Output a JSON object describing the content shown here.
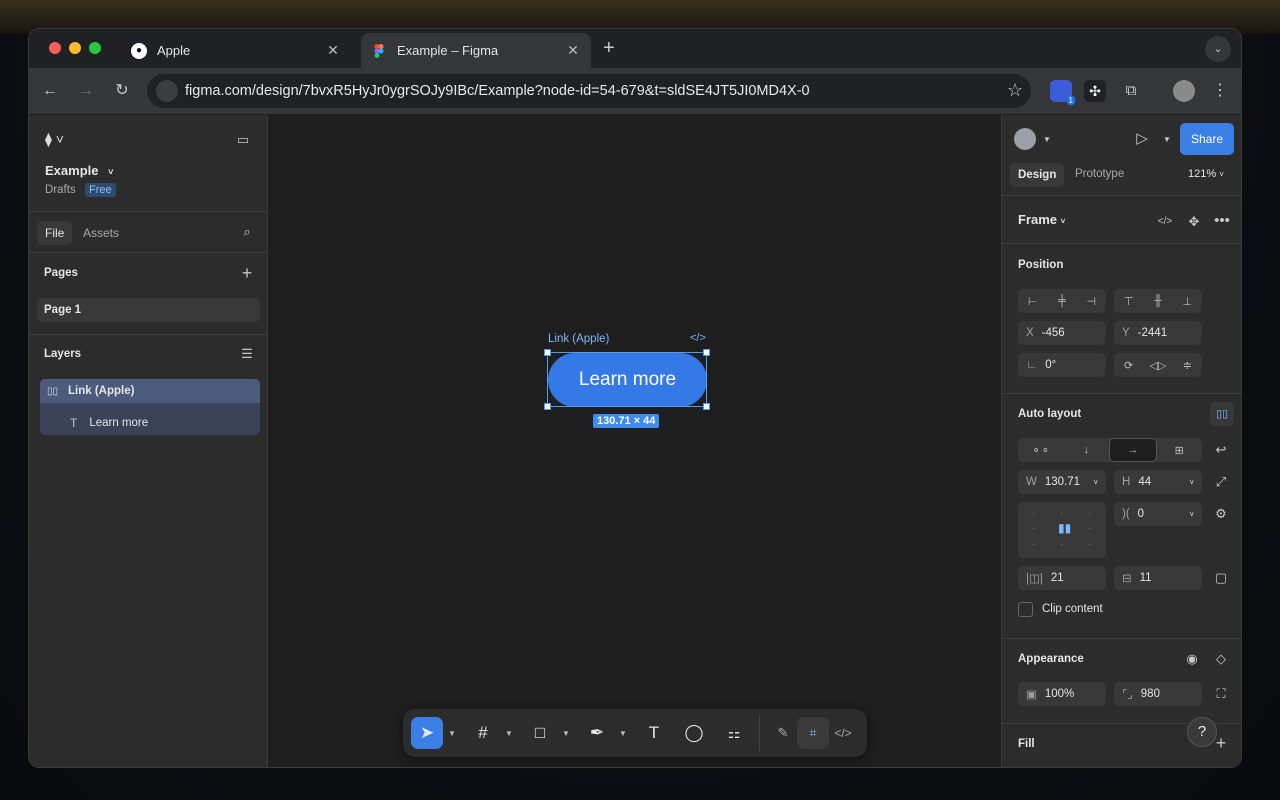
{
  "browser": {
    "tabs": [
      {
        "title": "Apple",
        "icon": "apple-icon"
      },
      {
        "title": "Example – Figma",
        "icon": "figma-icon"
      }
    ],
    "url": "figma.com/design/7bvxR5HyJr0ygrSOJy9IBc/Example?node-id=54-679&t=sldSE4JT5JI0MD4X-0",
    "ext_badge": "1"
  },
  "left": {
    "file_name": "Example",
    "drafts": "Drafts",
    "plan_badge": "Free",
    "tab_file": "File",
    "tab_assets": "Assets",
    "pages_title": "Pages",
    "pages": [
      "Page 1"
    ],
    "layers_title": "Layers",
    "layers": [
      {
        "name": "Link (Apple)",
        "icon": "auto-layout-icon"
      },
      {
        "name": "Learn more",
        "icon": "text-icon"
      }
    ]
  },
  "canvas": {
    "frame_label": "Link (Apple)",
    "button_text": "Learn more",
    "size_badge": "130.71 × 44",
    "colors": {
      "button": "#3479e6",
      "selection": "#4c9bff"
    }
  },
  "right": {
    "share": "Share",
    "tab_design": "Design",
    "tab_prototype": "Prototype",
    "zoom": "121%",
    "frame_type": "Frame",
    "position_title": "Position",
    "x_label": "X",
    "x_value": "-456",
    "y_label": "Y",
    "y_value": "-2441",
    "rotation": "0°",
    "autolayout_title": "Auto layout",
    "w_label": "W",
    "w_value": "130.71",
    "h_label": "H",
    "h_value": "44",
    "gap": "0",
    "pad_h": "21",
    "pad_v": "11",
    "clip_content": "Clip content",
    "appearance_title": "Appearance",
    "opacity": "100%",
    "radius": "980",
    "fill_title": "Fill",
    "help": "?"
  }
}
